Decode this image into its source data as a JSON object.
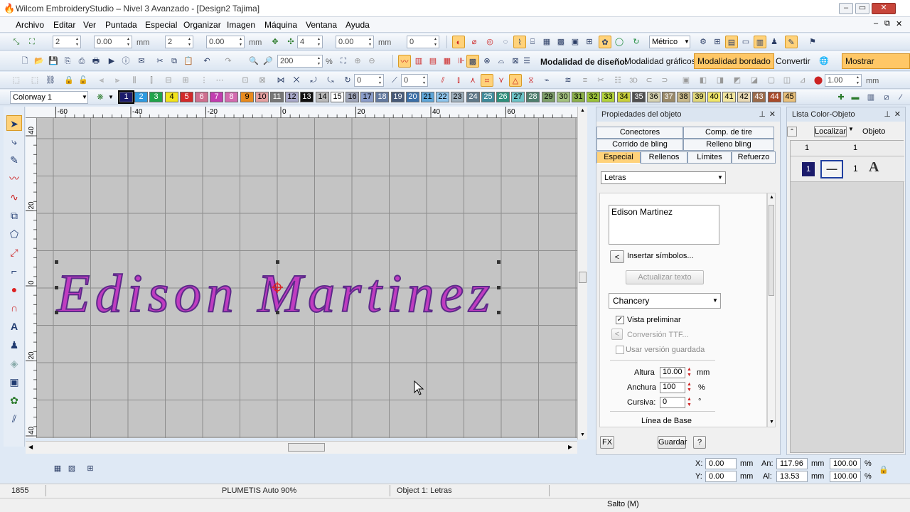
{
  "window": {
    "title": "Wilcom EmbroideryStudio – Nivel 3 Avanzado - [Design2        Tajima]"
  },
  "menu": [
    "Archivo",
    "Editar",
    "Ver",
    "Puntada",
    "Especial",
    "Organizar",
    "Imagen",
    "Máquina",
    "Ventana",
    "Ayuda"
  ],
  "toolbar1": {
    "v1": "2",
    "v2": "0.00",
    "unit1": "mm",
    "v3": "2",
    "v4": "0.00",
    "unit2": "mm",
    "v5": "4",
    "v6": "0.00",
    "unit3": "mm",
    "v7": "0",
    "units": "Métrico"
  },
  "toolbar2": {
    "zoom": "200",
    "zoom_unit": "%",
    "design_mode_label": "Modalidad de diseño:",
    "mode_graphics": "Modalidad gráficos",
    "mode_embroidery": "Modalidad bordado",
    "convert": "Convertir",
    "show_graphics": "Mostrar Gráficos"
  },
  "toolbar3": {
    "rot1": "0",
    "rot2": "0",
    "scale": "1.00",
    "scale_unit": "mm"
  },
  "colorway": {
    "selected": "Colorway 1",
    "swatches": [
      {
        "n": "1",
        "c": "#1b1b6b",
        "t": "#fff"
      },
      {
        "n": "2",
        "c": "#2f9be0",
        "t": "#fff"
      },
      {
        "n": "3",
        "c": "#21a34a",
        "t": "#fff"
      },
      {
        "n": "4",
        "c": "#f2e31c",
        "t": "#000"
      },
      {
        "n": "5",
        "c": "#d22a2a",
        "t": "#fff"
      },
      {
        "n": "6",
        "c": "#cf6f8f",
        "t": "#fff"
      },
      {
        "n": "7",
        "c": "#c23db0",
        "t": "#fff"
      },
      {
        "n": "8",
        "c": "#d36bb0",
        "t": "#fff"
      },
      {
        "n": "9",
        "c": "#e88b1f",
        "t": "#000"
      },
      {
        "n": "10",
        "c": "#e4a0a0",
        "t": "#000"
      },
      {
        "n": "11",
        "c": "#777",
        "t": "#fff"
      },
      {
        "n": "12",
        "c": "#a8a8c8",
        "t": "#000"
      },
      {
        "n": "13",
        "c": "#111",
        "t": "#fff"
      },
      {
        "n": "14",
        "c": "#b9b9b9",
        "t": "#000"
      },
      {
        "n": "15",
        "c": "#fff",
        "t": "#000"
      },
      {
        "n": "16",
        "c": "#9ea4b8",
        "t": "#000"
      },
      {
        "n": "17",
        "c": "#8a9cc9",
        "t": "#000"
      },
      {
        "n": "18",
        "c": "#63799e",
        "t": "#fff"
      },
      {
        "n": "19",
        "c": "#475a78",
        "t": "#fff"
      },
      {
        "n": "20",
        "c": "#3c70a8",
        "t": "#fff"
      },
      {
        "n": "21",
        "c": "#5fa6d8",
        "t": "#000"
      },
      {
        "n": "22",
        "c": "#8fc5ec",
        "t": "#000"
      },
      {
        "n": "23",
        "c": "#9fb0bd",
        "t": "#000"
      },
      {
        "n": "24",
        "c": "#5f7888",
        "t": "#fff"
      },
      {
        "n": "25",
        "c": "#3f8a9a",
        "t": "#fff"
      },
      {
        "n": "26",
        "c": "#2e8f7c",
        "t": "#fff"
      },
      {
        "n": "27",
        "c": "#6cc2c6",
        "t": "#000"
      },
      {
        "n": "28",
        "c": "#4f7f6e",
        "t": "#fff"
      },
      {
        "n": "29",
        "c": "#7ea06a",
        "t": "#000"
      },
      {
        "n": "30",
        "c": "#a4c27f",
        "t": "#000"
      },
      {
        "n": "31",
        "c": "#8bb04a",
        "t": "#000"
      },
      {
        "n": "32",
        "c": "#9bc23a",
        "t": "#000"
      },
      {
        "n": "33",
        "c": "#b2d23a",
        "t": "#000"
      },
      {
        "n": "34",
        "c": "#c9cf3a",
        "t": "#000"
      },
      {
        "n": "35",
        "c": "#505050",
        "t": "#fff"
      },
      {
        "n": "36",
        "c": "#d6d2b0",
        "t": "#000"
      },
      {
        "n": "37",
        "c": "#9a8a6a",
        "t": "#fff"
      },
      {
        "n": "38",
        "c": "#c9b98a",
        "t": "#000"
      },
      {
        "n": "39",
        "c": "#e0d77a",
        "t": "#000"
      },
      {
        "n": "40",
        "c": "#f0e66a",
        "t": "#000"
      },
      {
        "n": "41",
        "c": "#f3e7a0",
        "t": "#000"
      },
      {
        "n": "42",
        "c": "#e8d9b5",
        "t": "#000"
      },
      {
        "n": "43",
        "c": "#9a6a4a",
        "t": "#fff"
      },
      {
        "n": "44",
        "c": "#a84a2a",
        "t": "#fff"
      },
      {
        "n": "45",
        "c": "#e9c07a",
        "t": "#000"
      }
    ]
  },
  "rulers": {
    "top": [
      "-60",
      "-40",
      "-20",
      "0",
      "20",
      "40",
      "60"
    ],
    "left": [
      "40",
      "20",
      "0",
      "20",
      "40"
    ]
  },
  "design": {
    "text": "Edison Martinez",
    "fill": "#c03cc0",
    "stroke": "#5d2a8a"
  },
  "props": {
    "title": "Propiedades del objeto",
    "tabs_row1": [
      "Conectores",
      "Comp. de tire"
    ],
    "tabs_row2": [
      "Corrido de bling",
      "Relleno bling"
    ],
    "tabs_row3": [
      "Especial",
      "Rellenos",
      "Límites",
      "Refuerzo"
    ],
    "type_select": "Letras",
    "text_value": "Edison Martinez",
    "insert_symbols": "Insertar símbolos...",
    "update_text": "Actualizar texto",
    "font": "Chancery",
    "preview_label": "Vista preliminar",
    "ttf_label": "Conversión TTF...",
    "saved_label": "Usar versión guardada",
    "height_label": "Altura",
    "height": "10.00",
    "height_unit": "mm",
    "width_label": "Anchura",
    "width": "100",
    "width_unit": "%",
    "italic_label": "Cursiva:",
    "italic": "0",
    "italic_unit": "°",
    "baseline": "Línea de Base",
    "fx": "FX",
    "save": "Guardar",
    "help": "?"
  },
  "colorlist": {
    "title": "Lista Color-Objeto",
    "locate": "Localizar",
    "object_col": "Objeto",
    "row_top": [
      "1",
      "1"
    ],
    "row": [
      "1",
      "1"
    ]
  },
  "coords": {
    "x_label": "X:",
    "x": "0.00",
    "y_label": "Y:",
    "y": "0.00",
    "unit": "mm",
    "w_label": "An:",
    "w": "117.96",
    "h_label": "Al:",
    "h": "13.53",
    "wp": "100.00",
    "hp": "100.00",
    "pct": "%"
  },
  "status": {
    "stitches": "1855",
    "stitch_type": "PLUMETIS Auto 90%",
    "object": "Object 1: Letras",
    "jump": "Salto (M)"
  }
}
